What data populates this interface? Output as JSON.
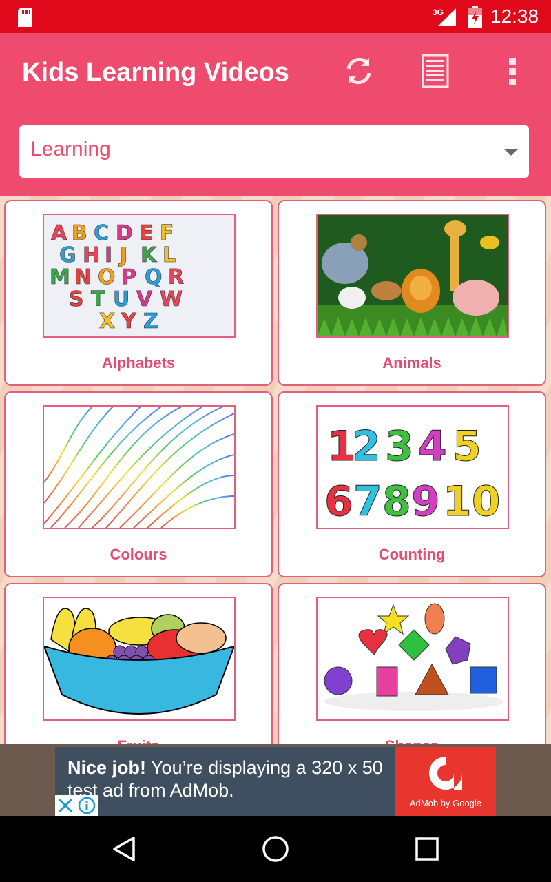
{
  "status_bar": {
    "network": "3G",
    "time": "12:38",
    "icons": [
      "sd-card-icon",
      "signal-icon",
      "battery-icon"
    ]
  },
  "app_bar": {
    "title": "Kids Learning Videos",
    "actions": [
      "refresh-icon",
      "list-icon",
      "more-vert-icon"
    ]
  },
  "category": {
    "selected": "Learning"
  },
  "grid": {
    "items": [
      {
        "label": "Alphabets"
      },
      {
        "label": "Animals"
      },
      {
        "label": "Colours"
      },
      {
        "label": "Counting"
      },
      {
        "label": "Fruits"
      },
      {
        "label": "Shapes"
      }
    ]
  },
  "ad": {
    "bold": "Nice job!",
    "text": " You’re displaying a 320 x 50 test ad from AdMob.",
    "brand": "AdMob by Google"
  },
  "colors": {
    "status_bar": "#e0091b",
    "app_bar": "#ef4b6f",
    "accent": "#e24d72"
  }
}
